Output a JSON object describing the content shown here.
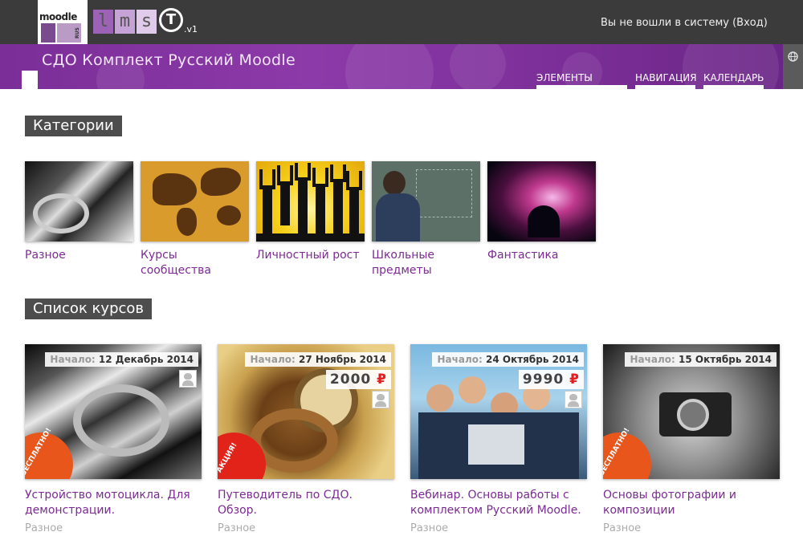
{
  "header": {
    "logo_moodle": "moodle",
    "logo_rus": "RUS",
    "logo_letters": [
      "l",
      "m",
      "s"
    ],
    "logo_t": "T",
    "logo_version": ".v1",
    "login_status": "Вы не вошли в систему (Вход)"
  },
  "banner": {
    "site_title": "СДО Комплект Русский Moodle",
    "nav": [
      "ЭЛЕМЕНТЫ КУРСА",
      "НАВИГАЦИЯ",
      "КАЛЕНДАРЬ"
    ],
    "side_icon": "globe-icon"
  },
  "categories": {
    "heading": "Категории",
    "items": [
      {
        "label": "Разное"
      },
      {
        "label": "Курсы сообщества"
      },
      {
        "label": "Личностный рост"
      },
      {
        "label": "Школьные предметы"
      },
      {
        "label": "Фантастика"
      }
    ]
  },
  "courses": {
    "heading": "Список курсов",
    "start_label": "Начало:",
    "items": [
      {
        "date": "12 Декабрь 2014",
        "price": "",
        "currency": "",
        "ribbon": "БЕСПЛАТНО!",
        "title": "Устройство мотоцикла. Для демонстрации.",
        "category": "Разное"
      },
      {
        "date": "27 Ноябрь 2014",
        "price": "2000",
        "currency": "₽",
        "ribbon": "АКЦИЯ!",
        "title": "Путеводитель по СДО. Обзор.",
        "category": "Разное"
      },
      {
        "date": "24 Октябрь 2014",
        "price": "9990",
        "currency": "₽",
        "ribbon": "",
        "title": "Вебинар. Основы работы с комплектом Русский Moodle.",
        "category": "Разное"
      },
      {
        "date": "15 Октябрь 2014",
        "price": "",
        "currency": "",
        "ribbon": "БЕСПЛАТНО!",
        "title": "Основы фотографии и композиции",
        "category": "Разное"
      }
    ]
  },
  "colors": {
    "accent": "#7b2b92",
    "banner": "#8c3aa9",
    "topbar": "#3b3b3b",
    "ribbon": "#e8561c"
  }
}
